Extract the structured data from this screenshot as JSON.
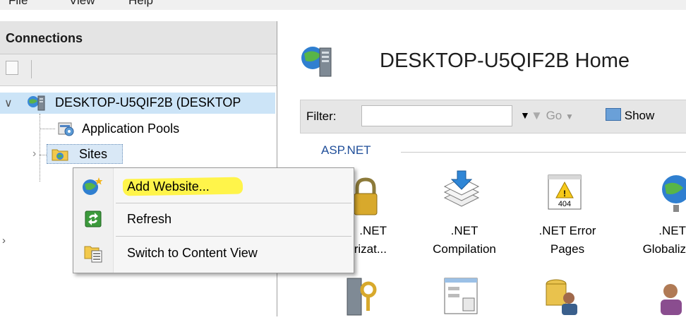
{
  "menubar": {
    "items": [
      "File",
      "View",
      "Help"
    ]
  },
  "connections": {
    "title": "Connections",
    "tree": {
      "server": "DESKTOP-U5QIF2B (DESKTOP",
      "app_pools": "Application Pools",
      "sites": "Sites"
    }
  },
  "home": {
    "title": "DESKTOP-U5QIF2B Home"
  },
  "filter": {
    "label": "Filter:",
    "value": "",
    "go": "Go",
    "show": "Show"
  },
  "section": {
    "label": "ASP.NET"
  },
  "features": [
    {
      "line1": ".NET",
      "line2": "Authorizat..."
    },
    {
      "line1": ".NET",
      "line2": "Compilation"
    },
    {
      "line1": ".NET Error",
      "line2": "Pages"
    },
    {
      "line1": ".NET",
      "line2": "Globaliz"
    }
  ],
  "context_menu": {
    "items": [
      {
        "label": "Add Website...",
        "icon": "add-website-icon"
      },
      {
        "label": "Refresh",
        "icon": "refresh-icon"
      },
      {
        "label": "Switch to Content View",
        "icon": "content-view-icon"
      }
    ]
  },
  "colors": {
    "highlight": "#fff44a",
    "selection": "#cce4f7",
    "section_text": "#1f4e99"
  }
}
